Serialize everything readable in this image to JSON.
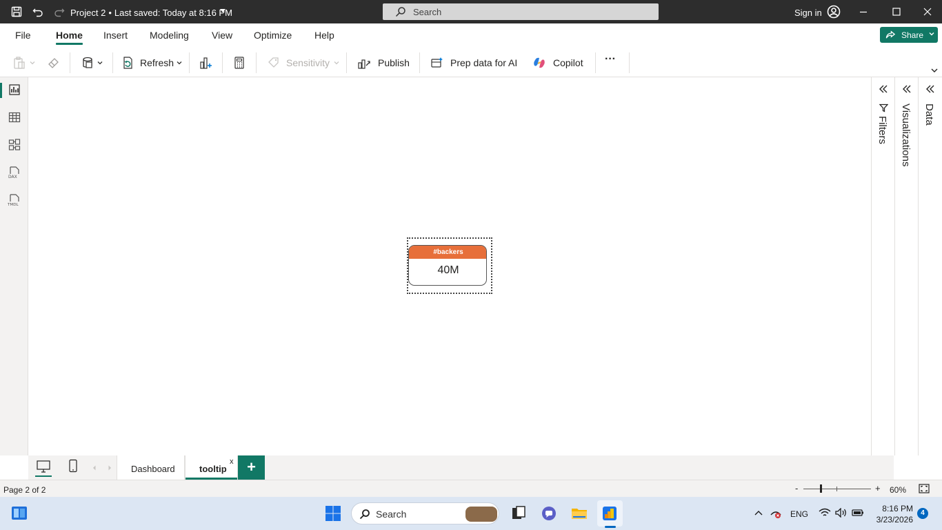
{
  "titlebar": {
    "project": "Project 2",
    "separator": "•",
    "saved": "Last saved: Today at 8:16 PM",
    "search_placeholder": "Search",
    "sign_in": "Sign in"
  },
  "menu": {
    "items": [
      "File",
      "Home",
      "Insert",
      "Modeling",
      "View",
      "Optimize",
      "Help"
    ],
    "active": "Home",
    "share_label": "Share"
  },
  "ribbon": {
    "refresh": "Refresh",
    "sensitivity": "Sensitivity",
    "publish": "Publish",
    "prep_ai": "Prep data for AI",
    "copilot": "Copilot",
    "more": "···"
  },
  "panes": {
    "filters": "Filters",
    "visualizations": "Visualizations",
    "data": "Data"
  },
  "card": {
    "header": "#backers",
    "value": "40M",
    "header_color": "#e76f3a"
  },
  "tabs": {
    "pages": [
      {
        "label": "Dashboard",
        "active": false
      },
      {
        "label": "tooltip",
        "active": true
      }
    ],
    "close": "x",
    "add": "+"
  },
  "status": {
    "page": "Page 2 of 2",
    "zoom_minus": "-",
    "zoom_plus": "+",
    "zoom": "60%",
    "zoom_fraction": 0.25
  },
  "taskbar": {
    "search": "Search",
    "lang": "ENG",
    "time": "8:16 PM",
    "date": "3/23/2026",
    "notifications": "4"
  },
  "colors": {
    "accent": "#117865",
    "titlebar": "#2d2d2d",
    "card_header": "#e76f3a"
  }
}
